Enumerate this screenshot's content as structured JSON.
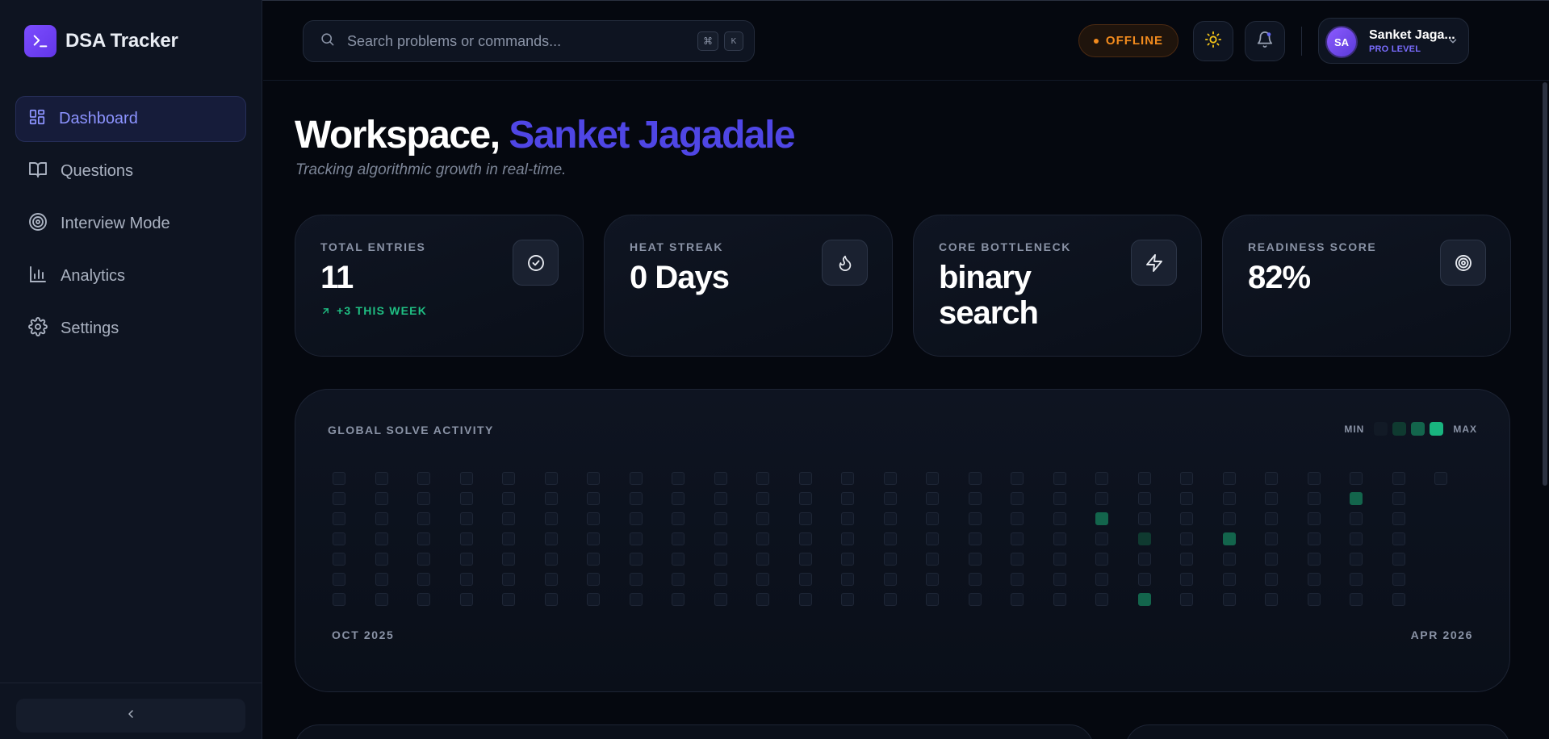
{
  "app": {
    "name": "DSA Tracker"
  },
  "sidebar": {
    "items": [
      {
        "label": "Dashboard",
        "icon": "dashboard-icon",
        "active": true
      },
      {
        "label": "Questions",
        "icon": "book-icon",
        "active": false
      },
      {
        "label": "Interview Mode",
        "icon": "target-icon",
        "active": false
      },
      {
        "label": "Analytics",
        "icon": "bar-chart-icon",
        "active": false
      },
      {
        "label": "Settings",
        "icon": "gear-icon",
        "active": false
      }
    ],
    "collapse_icon": "chevron-left-icon"
  },
  "header": {
    "search": {
      "placeholder": "Search problems or commands...",
      "shortcut_keys": [
        "⌘",
        "K"
      ]
    },
    "status": "OFFLINE",
    "user": {
      "initials": "SA",
      "name": "Sanket Jaga...",
      "level": "PRO LEVEL"
    }
  },
  "main": {
    "title_prefix": "Workspace,",
    "title_name": "Sanket Jagadale",
    "subtitle": "Tracking algorithmic growth in real-time.",
    "stats": [
      {
        "label": "TOTAL ENTRIES",
        "value": "11",
        "sub": "+3 THIS WEEK",
        "icon": "check-circle-icon"
      },
      {
        "label": "HEAT STREAK",
        "value": "0 Days",
        "sub": "",
        "icon": "flame-icon"
      },
      {
        "label": "CORE BOTTLENECK",
        "value": "binary search",
        "sub": "",
        "icon": "zap-icon"
      },
      {
        "label": "READINESS SCORE",
        "value": "82%",
        "sub": "",
        "icon": "target-icon"
      }
    ],
    "activity": {
      "title": "GLOBAL SOLVE ACTIVITY",
      "legend_min": "MIN",
      "legend_max": "MAX",
      "legend_colors": [
        "#121a26",
        "#0f3a30",
        "#13654c",
        "#19b47f"
      ],
      "start_label": "OCT 2025",
      "end_label": "APR 2026",
      "weeks": 27,
      "days": 7,
      "last_week_days": 1,
      "active_cells": [
        {
          "week": 24,
          "day": 1,
          "level": 2
        },
        {
          "week": 18,
          "day": 2,
          "level": 2
        },
        {
          "week": 19,
          "day": 3,
          "level": 1
        },
        {
          "week": 21,
          "day": 3,
          "level": 2
        },
        {
          "week": 19,
          "day": 6,
          "level": 2
        }
      ]
    }
  },
  "colors": {
    "accent": "#4f46e5",
    "brand": "#7c4dff",
    "success": "#1fbf83",
    "warning": "#f28b1e",
    "background": "#05080f",
    "sidebar": "#0e1421"
  }
}
